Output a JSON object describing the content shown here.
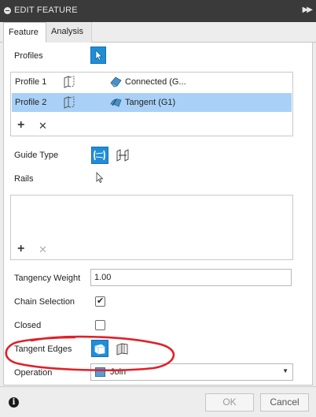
{
  "window": {
    "title": "EDIT FEATURE"
  },
  "tabs": [
    {
      "label": "Feature",
      "active": true
    },
    {
      "label": "Analysis",
      "active": false
    }
  ],
  "profiles": {
    "label": "Profiles",
    "rows": [
      {
        "name": "Profile 1",
        "condition": "Connected (G...",
        "selected": false
      },
      {
        "name": "Profile 2",
        "condition": "Tangent (G1)",
        "selected": true
      }
    ]
  },
  "guide_type": {
    "label": "Guide Type"
  },
  "rails": {
    "label": "Rails"
  },
  "tangency_weight": {
    "label": "Tangency Weight",
    "value": "1.00"
  },
  "chain_selection": {
    "label": "Chain Selection",
    "checked": true
  },
  "closed": {
    "label": "Closed",
    "checked": false
  },
  "tangent_edges": {
    "label": "Tangent Edges"
  },
  "operation": {
    "label": "Operation",
    "value": "Join"
  },
  "footer": {
    "ok_label": "OK",
    "cancel_label": "Cancel"
  },
  "colors": {
    "accent": "#1f8ed8",
    "selected_row": "#a9d1f7",
    "annotation": "#e0202a"
  }
}
